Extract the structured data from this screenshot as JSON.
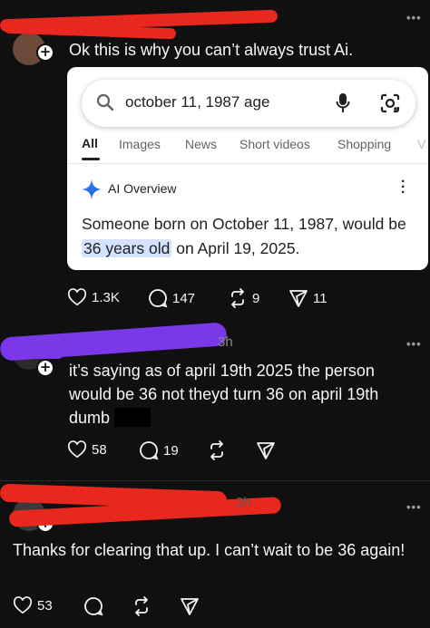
{
  "post1": {
    "text": "Ok this is why you can’t always trust Ai.",
    "search": {
      "query": "october 11, 1987 age",
      "tabs": [
        "All",
        "Images",
        "News",
        "Short videos",
        "Shopping",
        "V"
      ],
      "ai_label": "AI Overview",
      "answer_before": "Someone born on October 11, 1987, would be ",
      "answer_highlight": "36 years old",
      "answer_after": " on April 19, 2025."
    },
    "likes": "1.3K",
    "comments": "147",
    "reposts": "9",
    "shares": "11"
  },
  "post2": {
    "time": "3h",
    "text": "it’s saying as of april 19th 2025 the person would be 36 not theyd turn 36 on april 19th dumb",
    "likes": "58",
    "comments": "19"
  },
  "post3": {
    "time": "2h",
    "text": "Thanks for clearing that up. I can’t wait to be 36 again!",
    "likes": "53"
  },
  "colors": {
    "background": "#101010",
    "redaction_red": "#e8281e",
    "redaction_purple": "#7a38e8",
    "google_blue": "#4285f4",
    "highlight": "#d3e3fd"
  }
}
